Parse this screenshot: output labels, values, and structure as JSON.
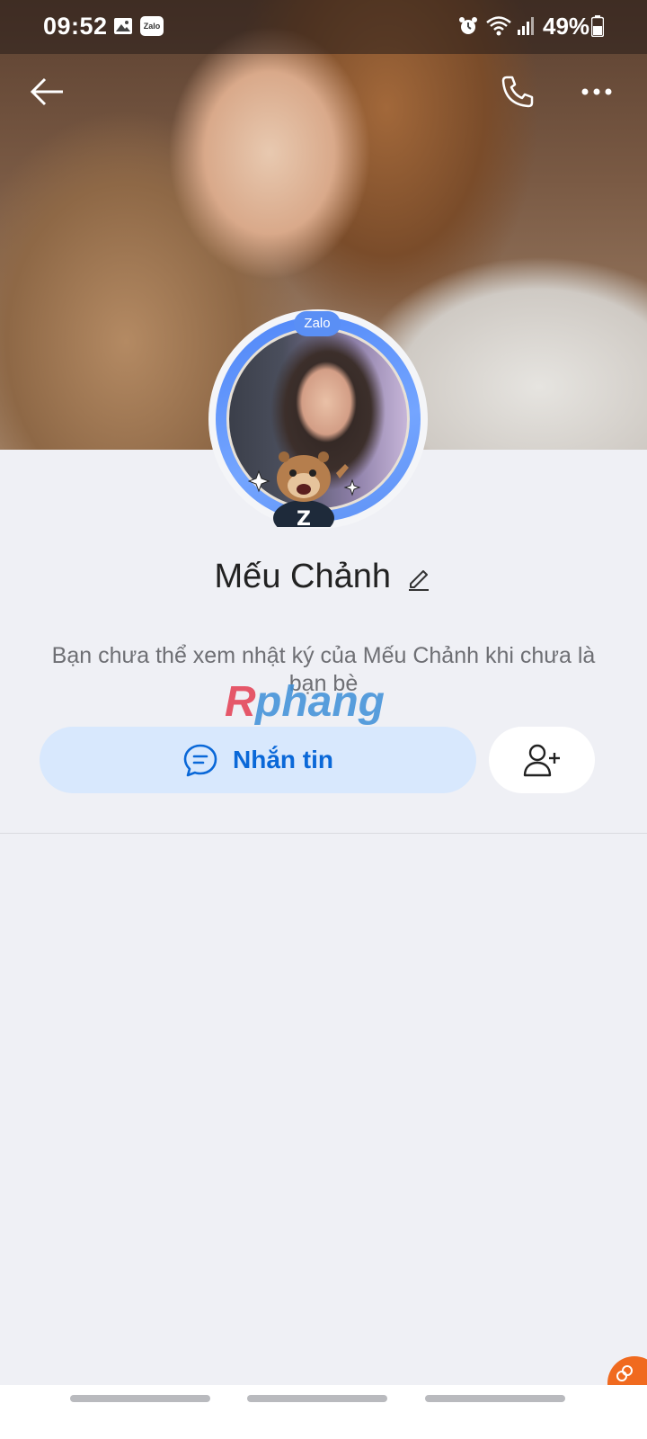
{
  "status_bar": {
    "time": "09:52",
    "zalo_icon_text": "Zalo",
    "battery": "49%"
  },
  "header": {
    "back_icon": "arrow-left-icon",
    "call_icon": "phone-icon",
    "more_icon": "more-horizontal-icon"
  },
  "profile": {
    "avatar_badge": "Zalo",
    "name": "Mếu Chảnh",
    "privacy_note": "Bạn chưa thể xem nhật ký của Mếu Chảnh khi chưa là bạn bè"
  },
  "actions": {
    "message_label": "Nhắn tin",
    "message_icon": "chat-bubble-icon",
    "add_friend_icon": "add-user-icon"
  },
  "watermark": {
    "text": "Rphang"
  },
  "colors": {
    "accent": "#0a68d8",
    "message_button_bg": "#d8e8fd",
    "page_bg": "#eff0f5",
    "avatar_ring": "#5a8ff5",
    "floating_badge": "#f06a1f"
  }
}
